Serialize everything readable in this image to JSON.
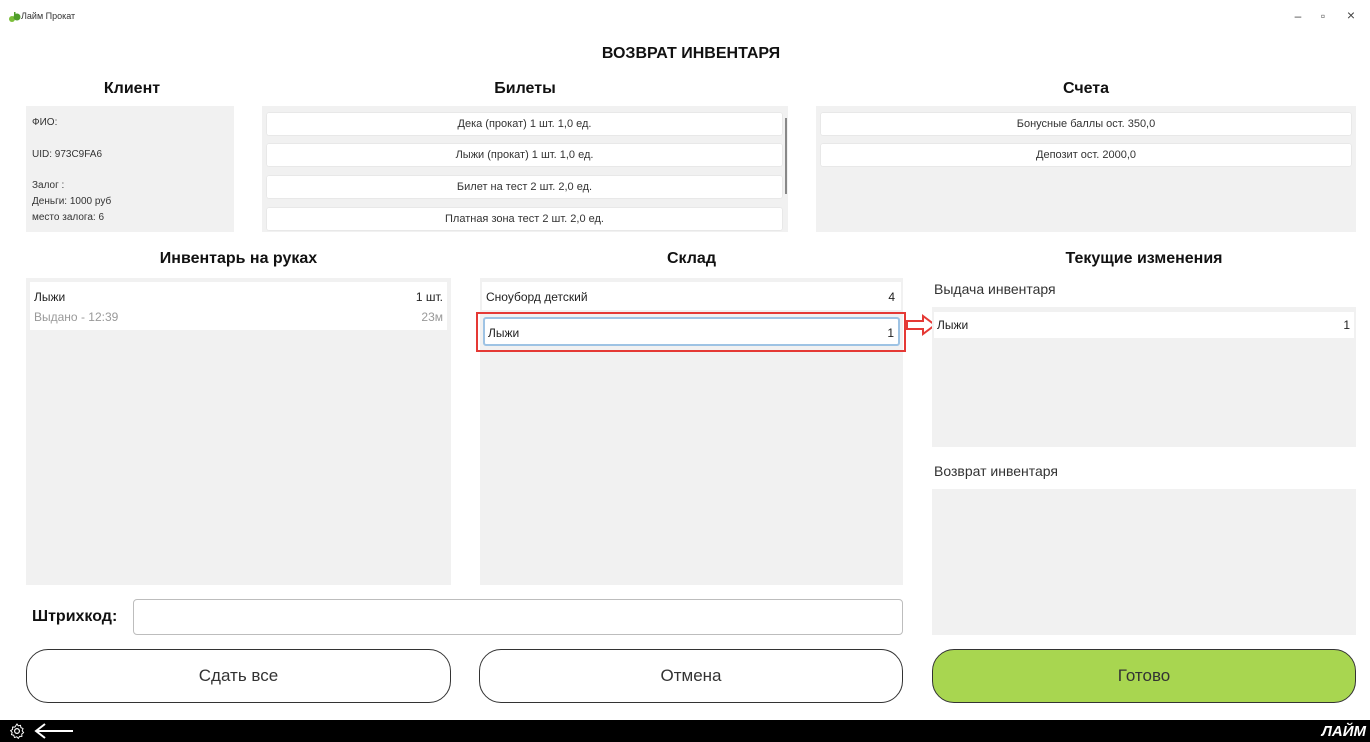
{
  "window": {
    "title": "Лайм Прокат",
    "minimize": "–",
    "restore": "▫",
    "close": "×"
  },
  "page_title": "ВОЗВРАТ ИНВЕНТАРЯ",
  "client": {
    "heading": "Клиент",
    "fio": "ФИО:",
    "uid": "UID: 973C9FA6",
    "deposit_label": "Залог :",
    "money": "Деньги: 1000 руб",
    "deposit_place": "место залога: 6"
  },
  "tickets": {
    "heading": "Билеты",
    "items": [
      "Дека (прокат) 1 шт. 1,0 ед.",
      "Лыжи (прокат) 1 шт. 1,0 ед.",
      "Билет на тест 2 шт. 2,0 ед.",
      "Платная зона тест 2 шт. 2,0 ед."
    ]
  },
  "accounts": {
    "heading": "Счета",
    "items": [
      "Бонусные баллы ост. 350,0",
      "Депозит ост. 2000,0"
    ]
  },
  "on_hand": {
    "heading": "Инвентарь на руках",
    "items": [
      {
        "name": "Лыжи",
        "qty": "1 шт.",
        "status": "Выдано  -  12:39",
        "duration": "23м"
      }
    ]
  },
  "warehouse": {
    "heading": "Склад",
    "items": [
      {
        "name": "Сноуборд детский",
        "qty": "4"
      },
      {
        "name": "Лыжи",
        "qty": "1"
      }
    ]
  },
  "changes": {
    "heading": "Текущие изменения",
    "issue_label": "Выдача инвентаря",
    "issue_items": [
      {
        "name": "Лыжи",
        "qty": "1"
      }
    ],
    "return_label": "Возврат инвентаря"
  },
  "barcode": {
    "label": "Штрихкод:",
    "value": ""
  },
  "buttons": {
    "return_all": "Сдать все",
    "cancel": "Отмена",
    "done": "Готово"
  },
  "brand": "ЛАЙМ",
  "colors": {
    "accent_green": "#a8d650",
    "highlight_red": "#e53935",
    "selected_border": "#9ec3e4"
  }
}
